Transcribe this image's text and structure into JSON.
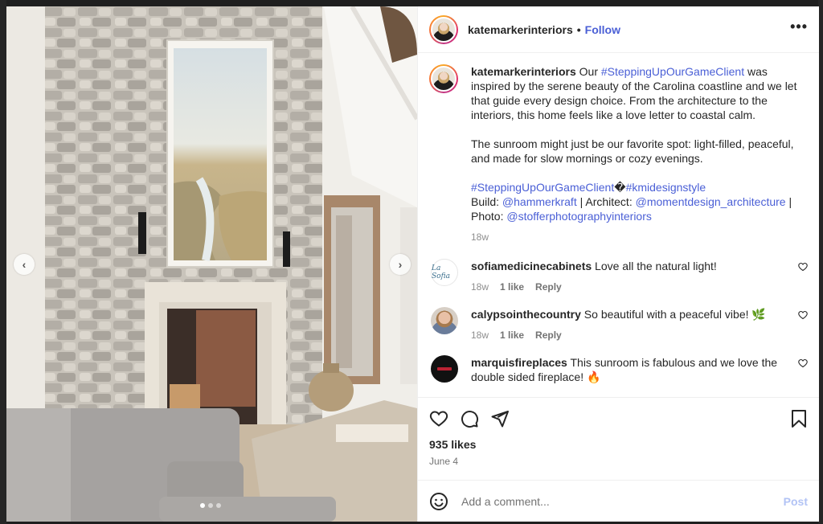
{
  "post": {
    "username": "katemarkerinteriors",
    "separator": "•",
    "follow_label": "Follow",
    "more_label": "•••",
    "caption": {
      "username": "katemarkerinteriors",
      "p1_pre": " Our ",
      "p1_tag": "#SteppingUpOurGameClient",
      "p1_post": " was inspired by the serene beauty of the Carolina coastline and we let that guide every design choice. From the architecture to the interiors, this home feels like a love letter to coastal calm.",
      "p2": "The sunroom might just be our favorite spot: light-filled, peaceful, and made for slow mornings or cozy evenings.",
      "tag1": "#SteppingUpOurGameClient",
      "tag_joiner": "�",
      "tag2": "#kmidesignstyle",
      "build_label": "Build: ",
      "build_handle": "@hammerkraft",
      "architect_label": " | Architect: ",
      "architect_handle": "@momentdesign_architecture",
      "photo_sep": " |",
      "photo_label": "Photo: ",
      "photo_handle": "@stofferphotographyinteriors",
      "age": "18w"
    },
    "comments": [
      {
        "username": "sofiamedicinecabinets",
        "text": " Love all the natural light!",
        "age": "18w",
        "likes": "1 like",
        "reply": "Reply",
        "avatar_text": "La Sofia"
      },
      {
        "username": "calypsointhecountry",
        "text": " So beautiful with a peaceful vibe! 🌿",
        "age": "18w",
        "likes": "1 like",
        "reply": "Reply"
      },
      {
        "username": "marquisfireplaces",
        "text": " This sunroom is fabulous and we love the double sided fireplace! 🔥"
      }
    ],
    "likes_count": "935 likes",
    "date": "June 4",
    "comment_placeholder": "Add a comment...",
    "post_label": "Post"
  },
  "carousel": {
    "prev_label": "‹",
    "next_label": "›",
    "slide_count": 3,
    "active_slide": 1
  },
  "icons": {
    "like": "heart-icon",
    "comment": "comment-bubble-icon",
    "share": "paper-plane-icon",
    "save": "bookmark-icon",
    "emoji": "smiley-icon"
  },
  "colors": {
    "link": "#4a5fd6",
    "post_disabled": "#b2c3f5",
    "meta": "#737373"
  }
}
